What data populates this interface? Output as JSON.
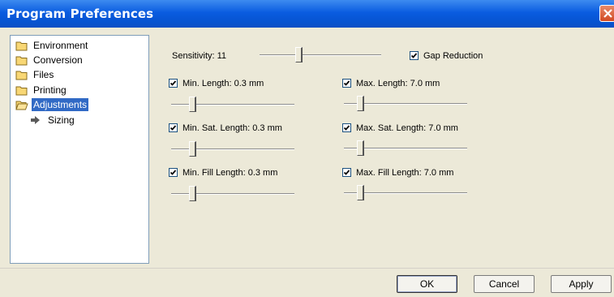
{
  "window": {
    "title": "Program Preferences"
  },
  "tree": {
    "items": [
      {
        "label": "Environment"
      },
      {
        "label": "Conversion"
      },
      {
        "label": "Files"
      },
      {
        "label": "Printing"
      },
      {
        "label": "Adjustments",
        "selected": true
      },
      {
        "label": "Sizing"
      }
    ]
  },
  "adjustments": {
    "sensitivity_label": "Sensitivity: 11",
    "sensitivity_value": 11,
    "gap_reduction": {
      "label": "Gap Reduction",
      "checked": true
    },
    "min_length": {
      "label": "Min. Length: 0.3 mm",
      "checked": true
    },
    "max_length": {
      "label": "Max. Length: 7.0 mm",
      "checked": true
    },
    "min_sat_length": {
      "label": "Min. Sat. Length: 0.3 mm",
      "checked": true
    },
    "max_sat_length": {
      "label": "Max. Sat. Length: 7.0 mm",
      "checked": true
    },
    "min_fill_length": {
      "label": "Min. Fill Length: 0.3 mm",
      "checked": true
    },
    "max_fill_length": {
      "label": "Max. Fill Length: 7.0 mm",
      "checked": true
    }
  },
  "buttons": {
    "ok": "OK",
    "cancel": "Cancel",
    "apply": "Apply"
  },
  "colors": {
    "title_bar": "#0a5ce0",
    "selection": "#316ac5",
    "dialog_bg": "#ece9d8"
  }
}
